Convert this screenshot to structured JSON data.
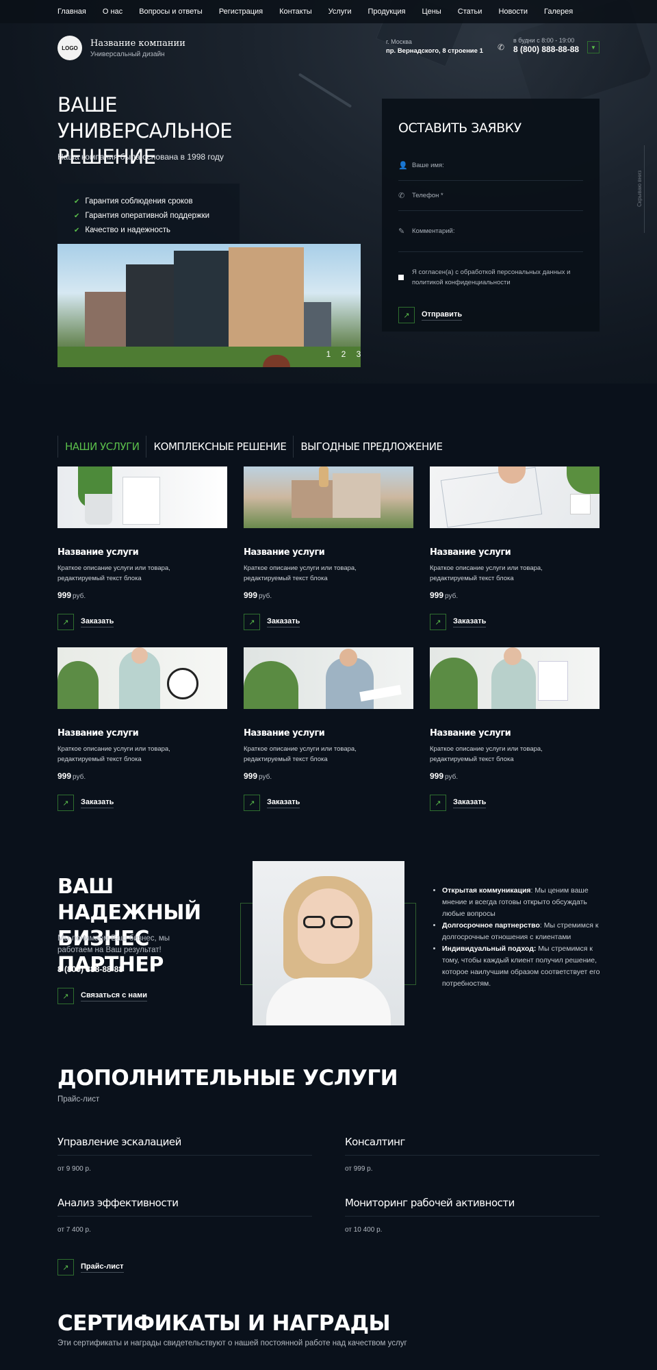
{
  "nav": [
    "Главная",
    "О нас",
    "Вопросы и ответы",
    "Регистрация",
    "Контакты",
    "Услуги",
    "Продукция",
    "Цены",
    "Статьи",
    "Новости",
    "Галерея"
  ],
  "header": {
    "logo": "LOGO",
    "company": "Название компании",
    "tagline": "Универсальный дизайн",
    "city": "г. Москва",
    "address": "пр. Вернадского, 8 строение 1",
    "hours": "в будни с 8:00 - 19:00",
    "phone": "8 (800) 888-88-88"
  },
  "hero": {
    "title": "Ваше универсальное решение",
    "subtitle": "Наша компания была основана в 1998 году",
    "features": [
      "Гарантия соблюдения сроков",
      "Гарантия оперативной поддержки",
      "Качество и надежность"
    ],
    "slides": [
      "1",
      "2",
      "3"
    ]
  },
  "form": {
    "title": "Оставить заявку",
    "name_placeholder": "Ваше имя:",
    "phone_placeholder": "Телефон *",
    "comment_placeholder": "Комментарий:",
    "agree": "Я согласен(а) с обработкой персональных данных и политикой конфиденциальности",
    "submit": "Отправить"
  },
  "side_label": "Скрываю вниз",
  "services": {
    "tabs": [
      "Наши услуги",
      "Комплексные решение",
      "Выгодные предложение"
    ],
    "cards": [
      {
        "title": "Название услуги",
        "desc": "Краткое описание услуги или товара, редактируемый текст блока",
        "price": "999",
        "currency": "руб.",
        "order": "Заказать"
      },
      {
        "title": "Название услуги",
        "desc": "Краткое описание услуги или товара, редактируемый текст блока",
        "price": "999",
        "currency": "руб.",
        "order": "Заказать"
      },
      {
        "title": "Название услуги",
        "desc": "Краткое описание услуги или товара, редактируемый текст блока",
        "price": "999",
        "currency": "руб.",
        "order": "Заказать"
      },
      {
        "title": "Название услуги",
        "desc": "Краткое описание услуги или товара, редактируемый текст блока",
        "price": "999",
        "currency": "руб.",
        "order": "Заказать"
      },
      {
        "title": "Название услуги",
        "desc": "Краткое описание услуги или товара, редактируемый текст блока",
        "price": "999",
        "currency": "руб.",
        "order": "Заказать"
      },
      {
        "title": "Название услуги",
        "desc": "Краткое описание услуги или товара, редактируемый текст блока",
        "price": "999",
        "currency": "руб.",
        "order": "Заказать"
      }
    ]
  },
  "partner": {
    "title": "Ваш надежный бизнес партнер",
    "subtitle": "Мы понимаем Ваш бизнес, мы работаем на Ваш результат!",
    "phone": "8 (800) 888-88-88",
    "cta": "Связаться с нами",
    "bullets": [
      {
        "bold": "Открытая коммуникация",
        "text": ": Мы ценим ваше мнение и всегда готовы открыто обсуждать любые вопросы"
      },
      {
        "bold": "Долгосрочное партнерство",
        "text": ": Мы стремимся к долгосрочные отношения с клиентами"
      },
      {
        "bold": "Индивидуальный подход:",
        "text": " Мы стремимся к тому, чтобы каждый клиент получил решение, которое наилучшим образом соответствует его потребностям."
      }
    ]
  },
  "extra": {
    "title": "Дополнительные услуги",
    "subtitle": "Прайс-лист",
    "items": [
      {
        "name": "Управление эскалацией",
        "price": "от 9 900 р."
      },
      {
        "name": "Консалтинг",
        "price": "от 999 р."
      },
      {
        "name": "Анализ эффективности",
        "price": "от 7 400 р."
      },
      {
        "name": "Мониторинг рабочей активности",
        "price": "от 10 400 р."
      }
    ],
    "button": "Прайс-лист"
  },
  "certs": {
    "title": "Сертификаты и награды",
    "subtitle": "Эти сертификаты и награды свидетельствуют о нашей постоянной работе над качеством услуг"
  },
  "colors": {
    "accent": "#5bbf4b",
    "background": "#0a111b"
  }
}
